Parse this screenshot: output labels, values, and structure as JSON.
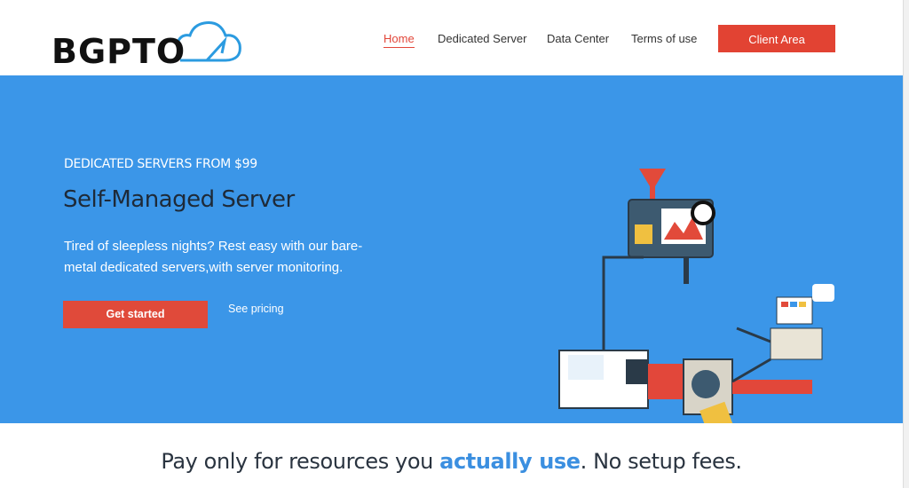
{
  "header": {
    "logo_text": "BGPTO",
    "nav": [
      "Home",
      "Dedicated Server",
      "Data Center",
      "Terms of use"
    ],
    "active_nav": "Home",
    "client_area": "Client Area"
  },
  "hero": {
    "eyebrow": "DEDICATED SERVERS FROM $99",
    "title": "Self-Managed Server",
    "description": "Tired of sleepless nights? Rest easy with our bare-metal dedicated servers,with server monitoring.",
    "cta": "Get started",
    "secondary": "See pricing",
    "background_color": "#3b96e8",
    "accent_color": "#e24333"
  },
  "tagline": {
    "before": "Pay only for resources you ",
    "highlight": "actually use",
    "after": ". No setup fees."
  }
}
